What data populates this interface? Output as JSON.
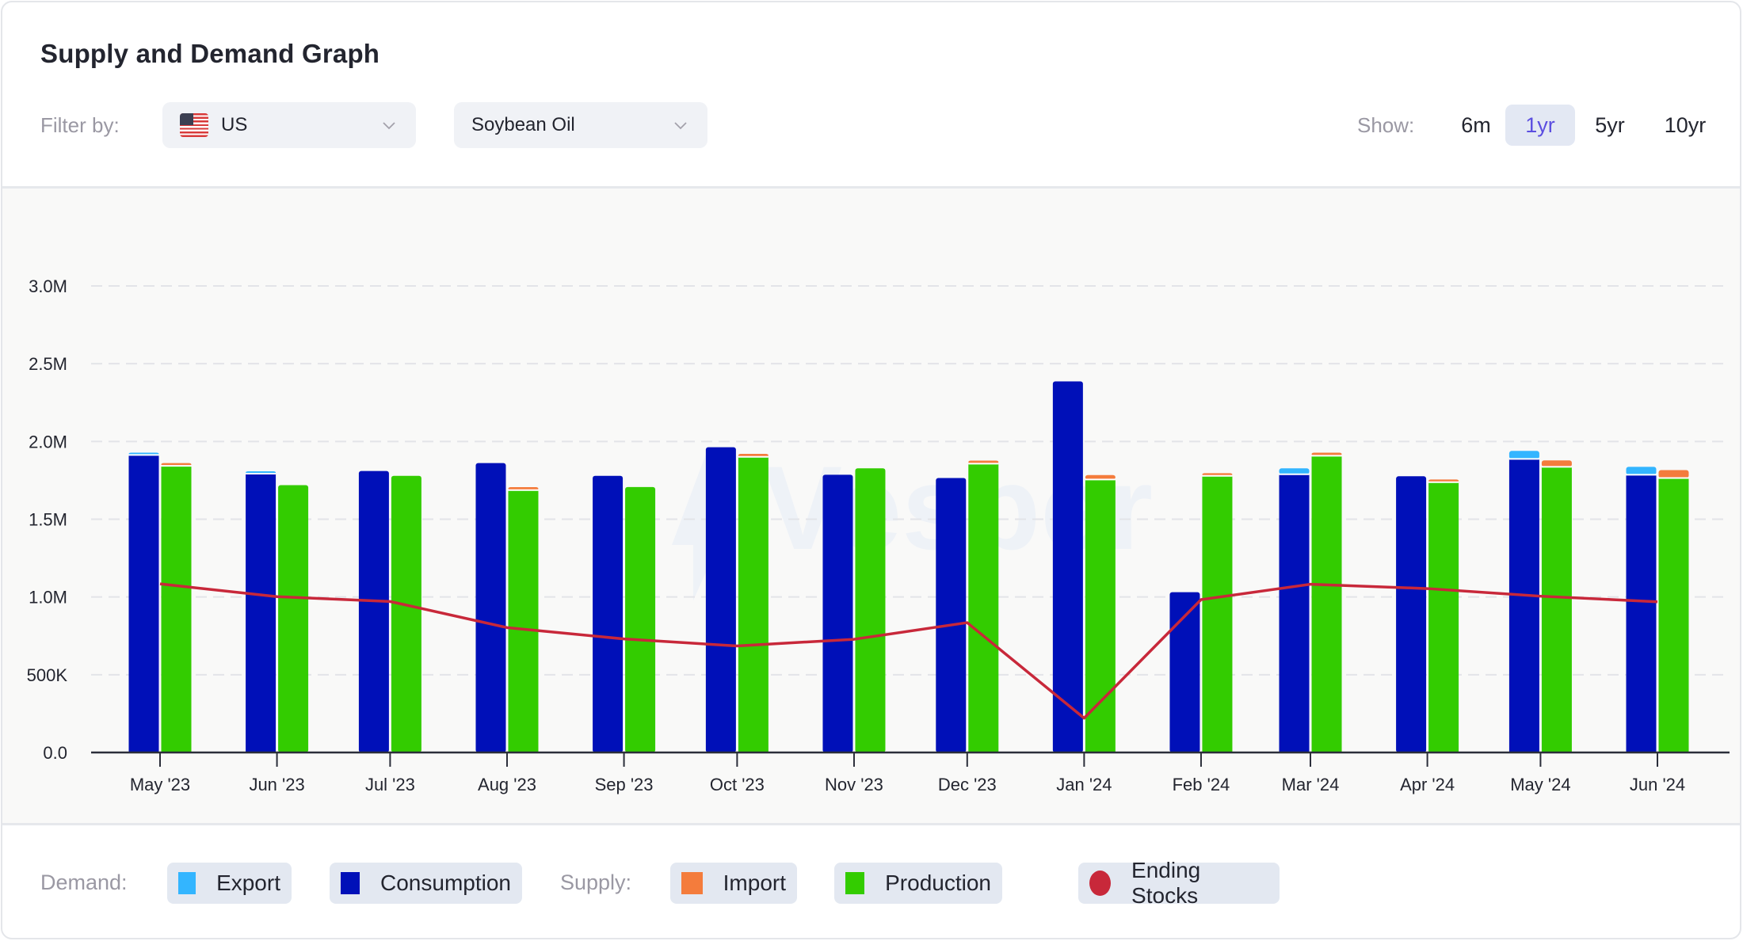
{
  "header": {
    "title": "Supply and Demand Graph",
    "filter_label": "Filter by:",
    "country": {
      "value": "US",
      "flag_icon": "us-flag-icon"
    },
    "product": {
      "value": "Soybean Oil"
    },
    "show_label": "Show:",
    "ranges": [
      {
        "label": "6m",
        "active": false
      },
      {
        "label": "1yr",
        "active": true
      },
      {
        "label": "5yr",
        "active": false
      },
      {
        "label": "10yr",
        "active": false
      }
    ]
  },
  "watermark": "Vesper",
  "legend": {
    "demand_label": "Demand:",
    "supply_label": "Supply:",
    "items": [
      {
        "label": "Export",
        "color": "#33b5ff",
        "shape": "square"
      },
      {
        "label": "Consumption",
        "color": "#0010b8",
        "shape": "square"
      },
      {
        "label": "Import",
        "color": "#f47c3c",
        "shape": "square"
      },
      {
        "label": "Production",
        "color": "#33cc00",
        "shape": "square"
      },
      {
        "label": "Ending Stocks",
        "color": "#c8283a",
        "shape": "circle"
      }
    ]
  },
  "chart_data": {
    "type": "bar",
    "title": "Supply and Demand Graph",
    "xlabel": "",
    "ylabel": "",
    "ylim": [
      0,
      3000000
    ],
    "yticks": [
      {
        "value": 0,
        "label": "0.0"
      },
      {
        "value": 500000,
        "label": "500K"
      },
      {
        "value": 1000000,
        "label": "1.0M"
      },
      {
        "value": 1500000,
        "label": "1.5M"
      },
      {
        "value": 2000000,
        "label": "2.0M"
      },
      {
        "value": 2500000,
        "label": "2.5M"
      },
      {
        "value": 3000000,
        "label": "3.0M"
      }
    ],
    "grid": true,
    "legend_position": "bottom",
    "categories": [
      "May '23",
      "Jun '23",
      "Jul '23",
      "Aug '23",
      "Sep '23",
      "Oct '23",
      "Nov '23",
      "Dec '23",
      "Jan '24",
      "Feb '24",
      "Mar '24",
      "Apr '24",
      "May '24",
      "Jun '24"
    ],
    "category_day_offsets": [
      0,
      31,
      61,
      92,
      123,
      153,
      184,
      214,
      245,
      276,
      305,
      336,
      366,
      397
    ],
    "series": [
      {
        "name": "Consumption",
        "group": "Demand",
        "stack": "demand",
        "color": "#0010b8",
        "values": [
          1913000,
          1793000,
          1810000,
          1861000,
          1779000,
          1963000,
          1786000,
          1765000,
          2386000,
          1031000,
          1789000,
          1776000,
          1888000,
          1786000
        ]
      },
      {
        "name": "Export",
        "group": "Demand",
        "stack": "demand",
        "color": "#33b5ff",
        "values": [
          15000,
          15000,
          0,
          0,
          0,
          0,
          0,
          0,
          0,
          0,
          38000,
          0,
          51000,
          51000
        ]
      },
      {
        "name": "Production",
        "group": "Supply",
        "stack": "supply",
        "color": "#33cc00",
        "values": [
          1843000,
          1719000,
          1779000,
          1687000,
          1707000,
          1901000,
          1827000,
          1857000,
          1755000,
          1779000,
          1908000,
          1738000,
          1837000,
          1765000
        ]
      },
      {
        "name": "Import",
        "group": "Supply",
        "stack": "supply",
        "color": "#f47c3c",
        "values": [
          18000,
          0,
          0,
          19000,
          0,
          19000,
          0,
          20000,
          29000,
          17000,
          20000,
          17000,
          41000,
          51000
        ]
      },
      {
        "name": "Ending Stocks",
        "type": "line",
        "color": "#c8283a",
        "values": [
          1084000,
          1002000,
          971000,
          803000,
          730000,
          685000,
          728000,
          835000,
          221000,
          983000,
          1082000,
          1054000,
          1005000,
          969000
        ]
      }
    ]
  }
}
